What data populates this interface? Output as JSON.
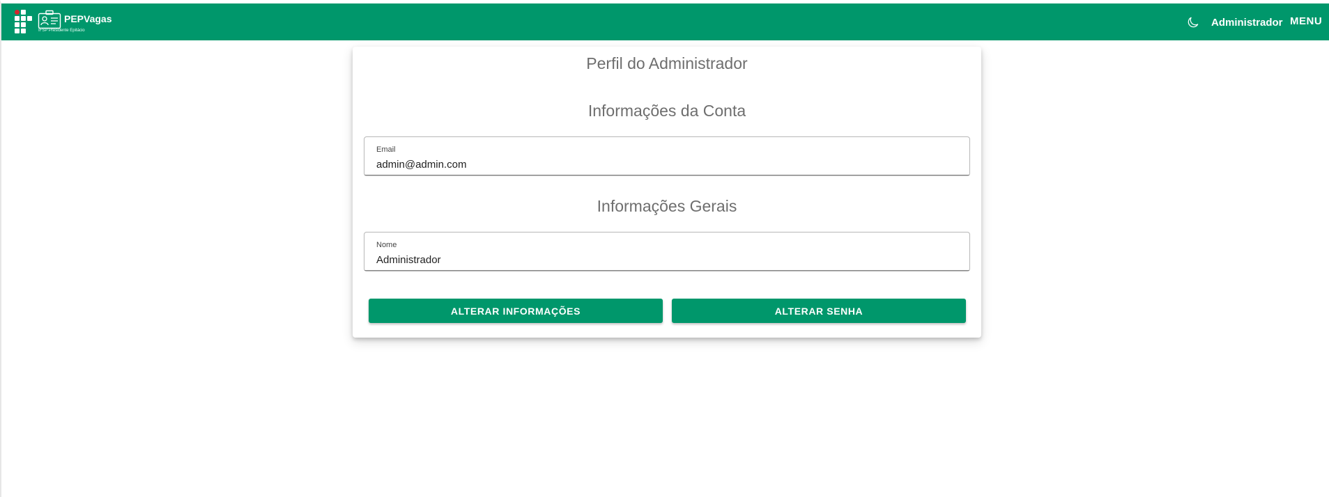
{
  "colors": {
    "primary": "#00976b",
    "logo_accent": "#d3262e"
  },
  "header": {
    "brand_title": "PEPVagas",
    "brand_subtitle": "IFSP Presidente Epitácio",
    "logo_icon": "ifsp-logo-icon",
    "badge_icon": "id-badge-icon",
    "theme_icon": "moon-icon",
    "user_name": "Administrador",
    "menu_label": "MENU"
  },
  "profile": {
    "title": "Perfil do Administrador",
    "account_section_title": "Informações da Conta",
    "email": {
      "label": "Email",
      "value": "admin@admin.com"
    },
    "general_section_title": "Informações Gerais",
    "name": {
      "label": "Nome",
      "value": "Administrador"
    },
    "buttons": {
      "update_info": "ALTERAR INFORMAÇÕES",
      "change_password": "ALTERAR SENHA"
    }
  }
}
